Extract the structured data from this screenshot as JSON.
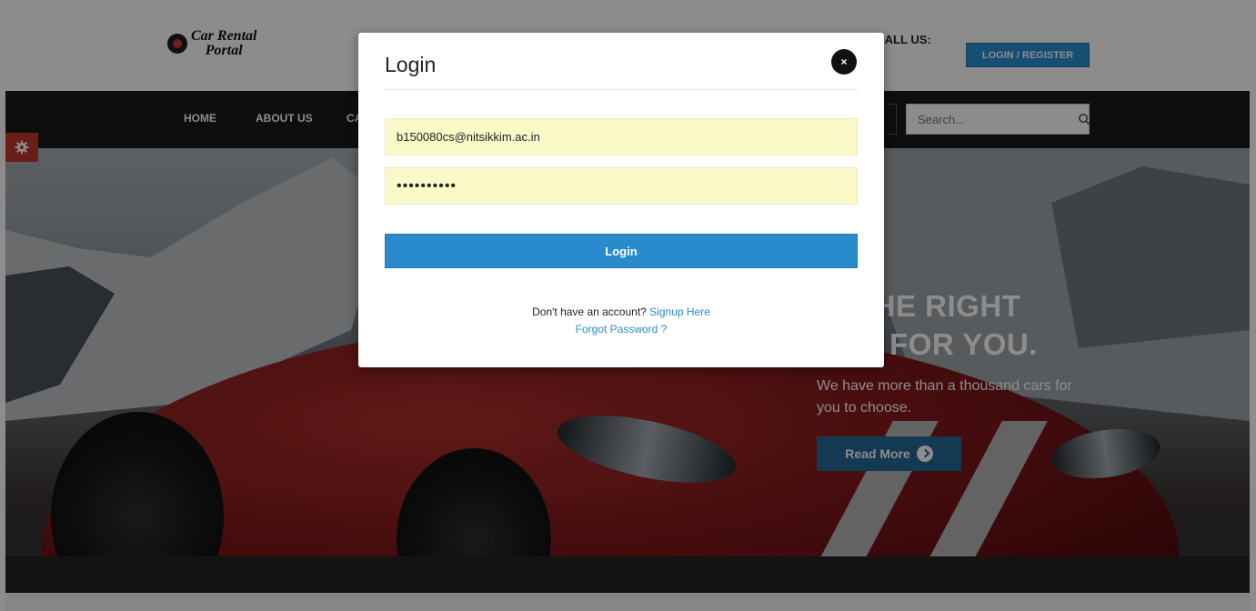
{
  "header": {
    "logo_line1": "Car Rental",
    "logo_line2": "Portal",
    "call_us": "E CALL US:",
    "login_register": "LOGIN / REGISTER"
  },
  "nav": {
    "items": [
      "HOME",
      "ABOUT US",
      "CA"
    ],
    "search_placeholder": "Search..."
  },
  "hero": {
    "heading_line1": "D THE RIGHT",
    "heading_line2": "FOR YOU.",
    "subtitle": "We have more than a thousand cars for you to choose.",
    "read_more": "Read More"
  },
  "modal": {
    "title": "Login",
    "close": "×",
    "email_value": "b150080cs@nitsikkim.ac.in",
    "password_value": "••••••••••",
    "login_button": "Login",
    "no_account_text": "Don't have an account?",
    "signup_link": "Signup Here",
    "forgot_link": "Forgot Password ?"
  },
  "colors": {
    "accent_blue": "#2a8bcc",
    "nav_dark": "#1a1a1a",
    "settings_red": "#c0392b",
    "autofill_yellow": "#fafac8"
  },
  "icons": [
    "settings-gear-icon",
    "search-icon",
    "close-icon",
    "arrow-right-circle-icon",
    "logo-icon"
  ]
}
